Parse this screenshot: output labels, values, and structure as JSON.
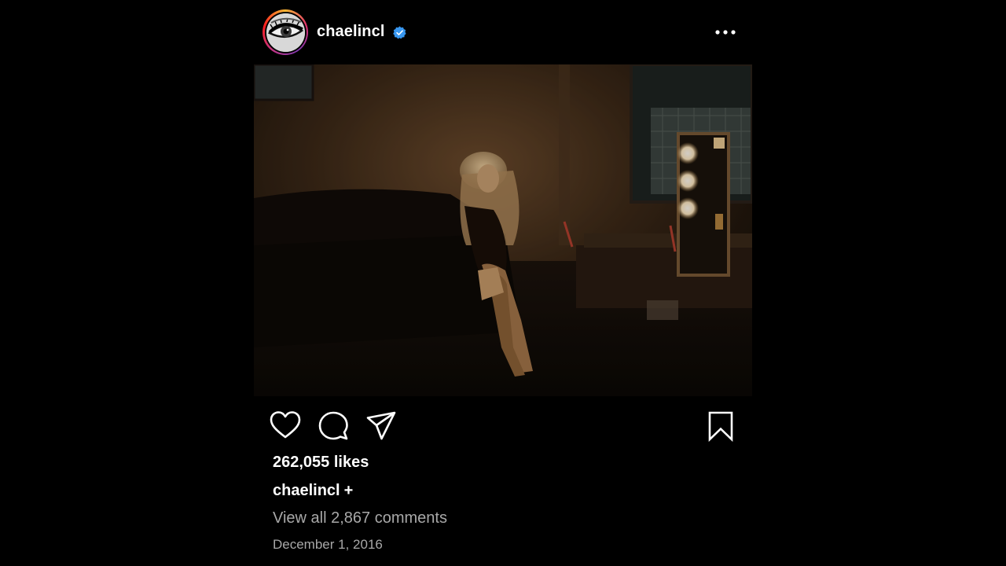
{
  "post": {
    "author": {
      "username": "chaelincl",
      "verified": true,
      "avatar": "eye-closeup-avatar"
    },
    "more_icon": "ellipsis-icon",
    "photo": "dim-room-woman-seated-vanity-mirror",
    "actions": {
      "like_icon": "heart-icon",
      "comment_icon": "comment-bubble-icon",
      "share_icon": "paper-plane-icon",
      "save_icon": "bookmark-icon"
    },
    "likes_text": "262,055 likes",
    "caption": {
      "username": "chaelincl",
      "text": "+"
    },
    "view_comments_text": "View all 2,867 comments",
    "date": "December 1, 2016",
    "colors": {
      "background": "#000000",
      "text": "#ffffff",
      "muted_text": "#a8a8a8",
      "verified_badge": "#3897f0"
    }
  }
}
